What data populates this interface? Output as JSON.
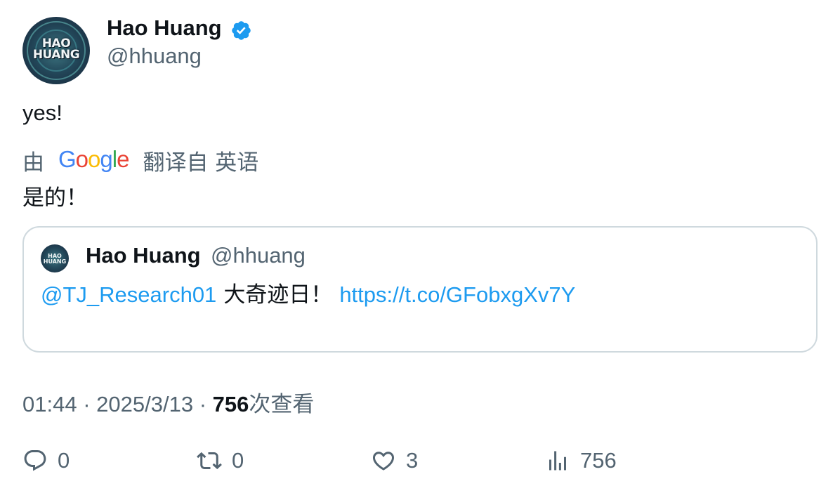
{
  "author": {
    "name": "Hao Huang",
    "handle": "@hhuang",
    "verified": true,
    "avatar_text_line1": "HAO",
    "avatar_text_line2": "HUANG"
  },
  "tweet": {
    "text": "yes!",
    "translation": {
      "by_label": "由",
      "provider_letters": [
        "G",
        "o",
        "o",
        "g",
        "l",
        "e"
      ],
      "from_label": "翻译自 英语",
      "translated_text": "是的！"
    }
  },
  "quoted_tweet": {
    "author_name": "Hao Huang",
    "author_handle": "@hhuang",
    "mention": "@TJ_Research01",
    "body": "大奇迹日！",
    "link": "https://t.co/GFobxgXv7Y"
  },
  "meta": {
    "time": "01:44",
    "separator": "·",
    "date": "2025/3/13",
    "views_count": "756",
    "views_label": "次查看"
  },
  "actions": {
    "reply_count": "0",
    "retweet_count": "0",
    "like_count": "3",
    "views_count": "756"
  },
  "colors": {
    "text_primary": "#0f1419",
    "text_secondary": "#536471",
    "link": "#1d9bf0",
    "border": "#cfd9de",
    "verified": "#1d9bf0"
  }
}
